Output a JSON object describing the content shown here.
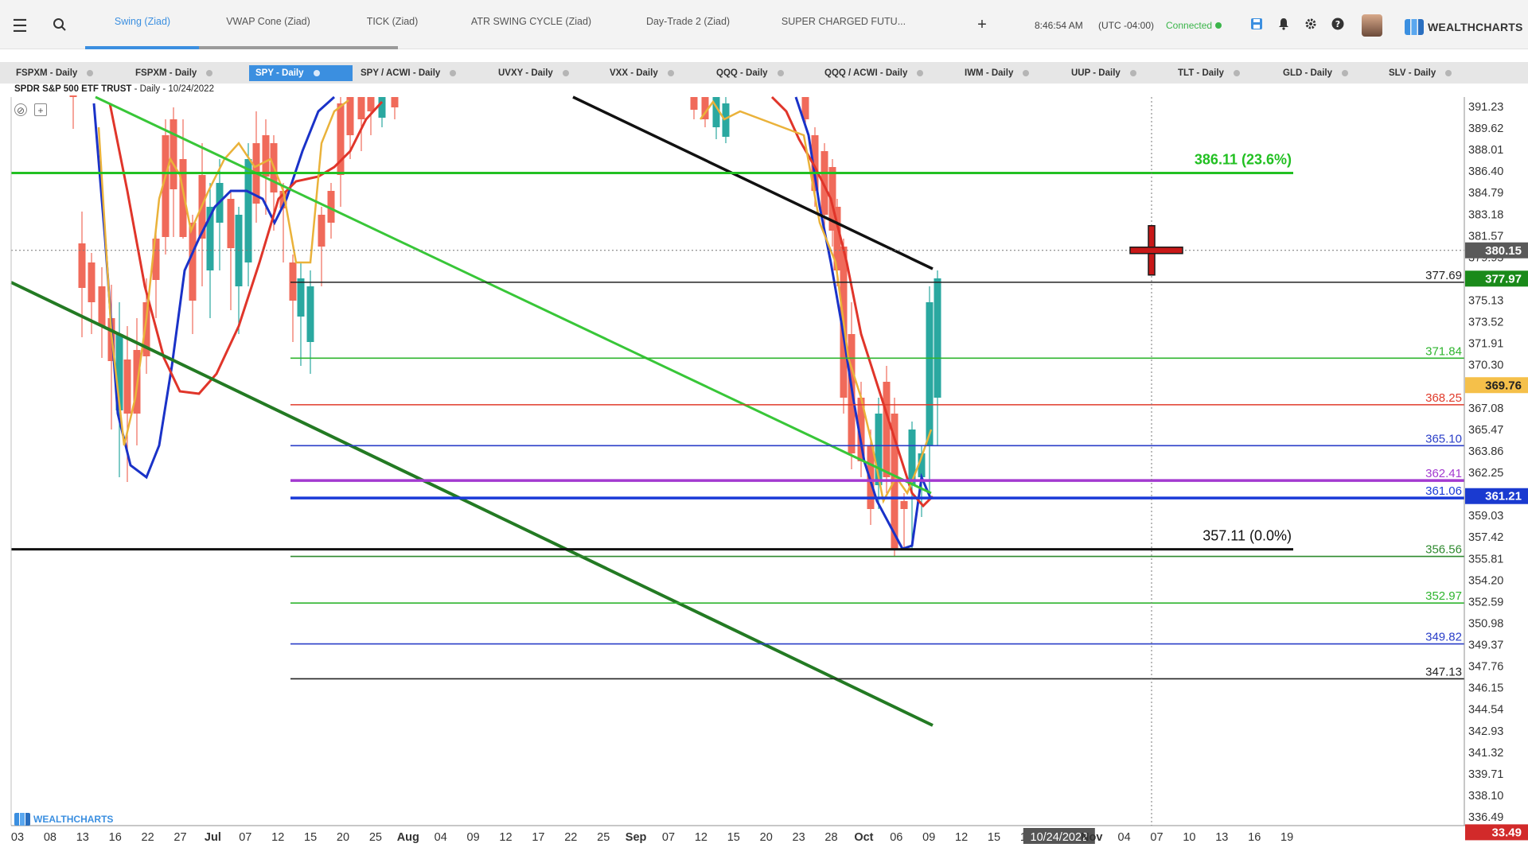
{
  "topbar": {
    "workspace_tabs": [
      {
        "label": "Swing (Ziad)",
        "active": true
      },
      {
        "label": "VWAP Cone (Ziad)",
        "active": false
      },
      {
        "label": "TICK (Ziad)",
        "active": false
      },
      {
        "label": "ATR SWING CYCLE (Ziad)",
        "active": false
      },
      {
        "label": "Day-Trade 2 (Ziad)",
        "active": false
      },
      {
        "label": "SUPER CHARGED FUTU...",
        "active": false
      }
    ],
    "add_tab": "+",
    "time": "8:46:54 AM",
    "timezone": "(UTC -04:00)",
    "connection_status": "Connected",
    "brand": "WEALTHCHARTS",
    "icons": [
      "menu-icon",
      "search-icon",
      "save-icon",
      "bell-icon",
      "gear-icon",
      "help-icon",
      "avatar"
    ]
  },
  "chart_tabs": [
    {
      "label": "FSPXM - Daily",
      "active": false
    },
    {
      "label": "FSPXM - Daily",
      "active": false
    },
    {
      "label": "SPY - Daily",
      "active": true
    },
    {
      "label": "SPY / ACWI - Daily",
      "active": false
    },
    {
      "label": "UVXY - Daily",
      "active": false
    },
    {
      "label": "VXX - Daily",
      "active": false
    },
    {
      "label": "QQQ - Daily",
      "active": false
    },
    {
      "label": "QQQ / ACWI - Daily",
      "active": false
    },
    {
      "label": "IWM - Daily",
      "active": false
    },
    {
      "label": "UUP - Daily",
      "active": false
    },
    {
      "label": "TLT - Daily",
      "active": false
    },
    {
      "label": "GLD - Daily",
      "active": false
    },
    {
      "label": "SLV - Daily",
      "active": false
    }
  ],
  "chart": {
    "symbol_name": "SPDR S&P 500 ETF TRUST",
    "interval_date": " - Daily - 10/24/2022",
    "watermark": "WEALTHCHARTS"
  },
  "chart_data": {
    "type": "line",
    "y_axis_ticks": [
      "391.23",
      "389.62",
      "388.01",
      "386.40",
      "384.79",
      "383.18",
      "381.57",
      "379.95",
      "376.74",
      "375.13",
      "373.52",
      "371.91",
      "370.30",
      "368.69",
      "367.08",
      "365.47",
      "363.86",
      "362.25",
      "360.40",
      "359.03",
      "357.42",
      "355.81",
      "354.20",
      "352.59",
      "350.98",
      "349.37",
      "347.76",
      "346.15",
      "344.54",
      "342.93",
      "341.32",
      "339.71",
      "338.10",
      "336.49"
    ],
    "ylim": [
      335.5,
      392.0
    ],
    "x_axis_ticks": [
      "03",
      "08",
      "13",
      "16",
      "22",
      "27",
      "Jul",
      "07",
      "12",
      "15",
      "20",
      "25",
      "Aug",
      "04",
      "09",
      "12",
      "17",
      "22",
      "25",
      "Sep",
      "07",
      "12",
      "15",
      "20",
      "23",
      "28",
      "Oct",
      "06",
      "09",
      "12",
      "15",
      "18",
      "10/24/2022",
      "Nov",
      "04",
      "07",
      "10",
      "13",
      "16",
      "19"
    ],
    "price_labels": [
      {
        "text": "380.15",
        "value": 380.15,
        "color": "#5a5a5a"
      },
      {
        "text": "377.97",
        "value": 377.97,
        "color": "#1a8a1a"
      },
      {
        "text": "369.76",
        "value": 369.76,
        "color": "#f5c04a"
      },
      {
        "text": "361.21",
        "value": 361.21,
        "color": "#1a3ad0"
      },
      {
        "text": "33.49",
        "value": 335.3,
        "color": "#d22a2a"
      }
    ],
    "horizontal_levels": [
      {
        "value": 377.69,
        "label": "377.69",
        "color": "#222222"
      },
      {
        "value": 371.84,
        "label": "371.84",
        "color": "#2fb52f"
      },
      {
        "value": 368.25,
        "label": "368.25",
        "color": "#e03a2a"
      },
      {
        "value": 365.1,
        "label": "365.10",
        "color": "#2a3ec8"
      },
      {
        "value": 362.41,
        "label": "362.41",
        "color": "#a33ad0"
      },
      {
        "value": 361.06,
        "label": "361.06",
        "color": "#1a3ad8"
      },
      {
        "value": 356.56,
        "label": "356.56",
        "color": "#2f8a2f"
      },
      {
        "value": 352.97,
        "label": "352.97",
        "color": "#2fb52f"
      },
      {
        "value": 349.82,
        "label": "349.82",
        "color": "#2a3ec8"
      },
      {
        "value": 347.13,
        "label": "347.13",
        "color": "#222222"
      }
    ],
    "fib_levels": [
      {
        "value": 386.11,
        "label": "386.11 (23.6%)",
        "color": "#22c022"
      },
      {
        "value": 357.11,
        "label": "357.11 (0.0%)",
        "color": "#111111"
      }
    ],
    "crosshair_price": 380.15
  }
}
